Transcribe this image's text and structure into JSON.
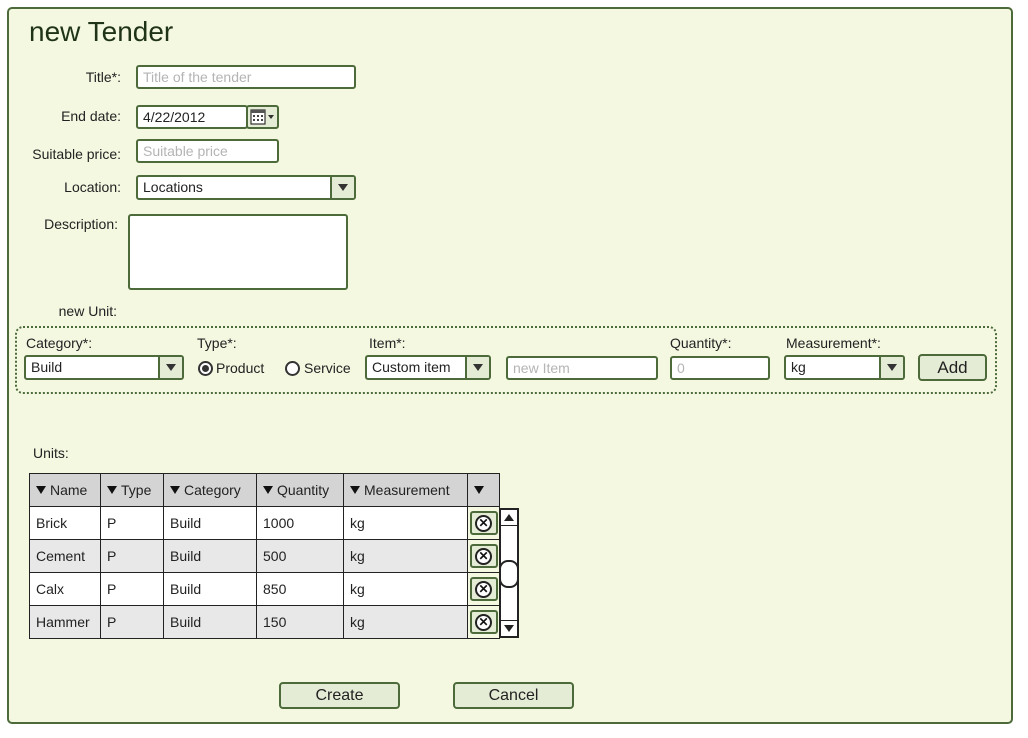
{
  "form": {
    "title": "new Tender",
    "title_label": "Title*:",
    "title_placeholder": "Title of the tender",
    "end_date_label": "End date:",
    "end_date_value": "4/22/2012",
    "suitable_price_label": "Suitable price:",
    "suitable_price_placeholder": "Suitable price",
    "location_label": "Location:",
    "location_value": "Locations",
    "description_label": "Description:",
    "description_value": ""
  },
  "new_unit": {
    "section_label": "new Unit:",
    "category_label": "Category*:",
    "category_value": "Build",
    "type_label": "Type*:",
    "type_options": [
      "Product",
      "Service"
    ],
    "type_selected": "Product",
    "item_label": "Item*:",
    "item_value": "Custom item",
    "new_item_placeholder": "new Item",
    "quantity_label": "Quantity*:",
    "quantity_placeholder": "0",
    "measurement_label": "Measurement*:",
    "measurement_value": "kg",
    "add_label": "Add"
  },
  "units": {
    "label": "Units:",
    "columns": [
      "Name",
      "Type",
      "Category",
      "Quantity",
      "Measurement"
    ],
    "rows": [
      [
        "Brick",
        "P",
        "Build",
        "1000",
        "kg"
      ],
      [
        "Cement",
        "P",
        "Build",
        "500",
        "kg"
      ],
      [
        "Calx",
        "P",
        "Build",
        "850",
        "kg"
      ],
      [
        "Hammer",
        "P",
        "Build",
        "150",
        "kg"
      ]
    ]
  },
  "actions": {
    "create_label": "Create",
    "cancel_label": "Cancel"
  },
  "colors": {
    "panel_bg": "#f5f8e1",
    "border": "#4d6b3a",
    "button_bg": "#e4ecd5",
    "header_bg": "#d4d4d4"
  },
  "icons": {
    "date_picker": "calendar-icon",
    "dropdown": "chevron-down-icon",
    "row_delete": "remove-circle-icon",
    "column_sort": "sort-down-icon"
  }
}
